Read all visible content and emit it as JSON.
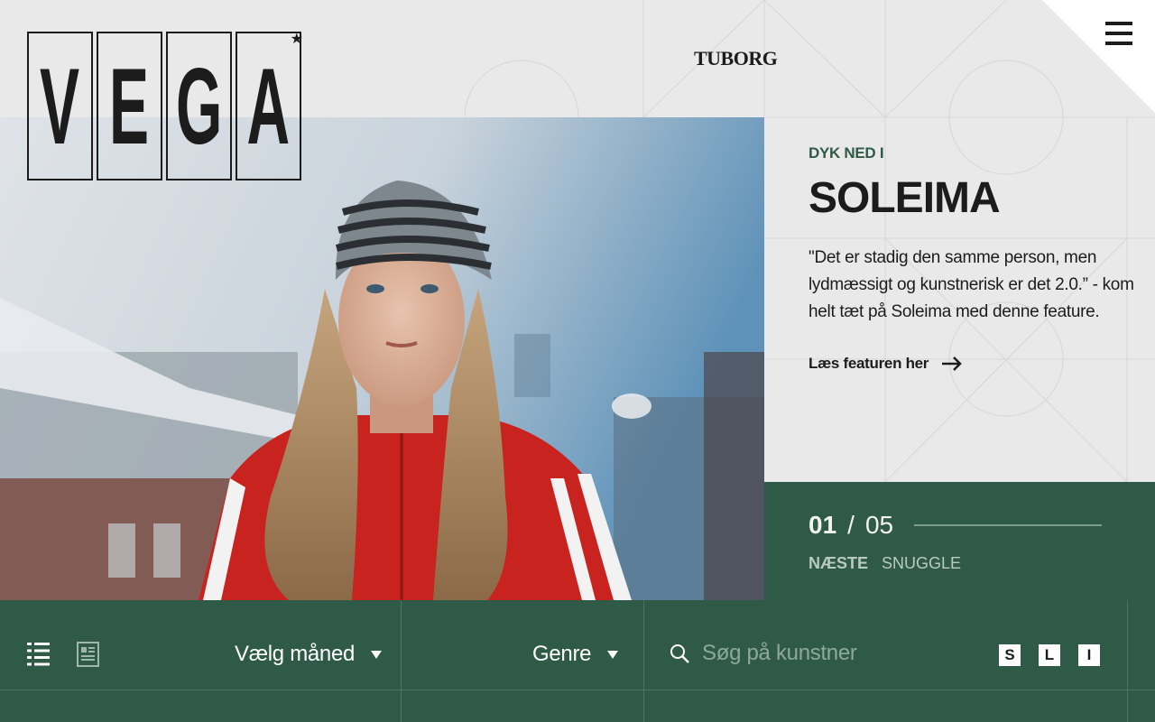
{
  "header": {
    "logo_letters": [
      "V",
      "E",
      "G",
      "A"
    ],
    "logo_star": "★",
    "sponsor": "TUBORG",
    "menu_icon": "hamburger-menu-icon"
  },
  "feature": {
    "eyebrow": "DYK NED I",
    "artist": "SOLEIMA",
    "quote": "\"Det er stadig den samme person, men lydmæssigt og kunstnerisk er det 2.0.” - kom helt tæt på Soleima med denne feature.",
    "cta_label": "Læs featuren her",
    "cta_icon": "arrow-right-icon"
  },
  "slider": {
    "current": "01",
    "separator": "/",
    "total": "05",
    "next_label": "NÆSTE",
    "next_title": "SNUGGLE"
  },
  "filters": {
    "list_view_icon": "list-view-icon",
    "document_view_icon": "document-view-icon",
    "month_label": "Vælg måned",
    "genre_label": "Genre",
    "search_icon": "search-icon",
    "search_placeholder": "Søg på kunstner",
    "sizes": [
      "S",
      "L",
      "I"
    ]
  },
  "colors": {
    "accent_green": "#2f5a47",
    "background": "#e9e9e9",
    "text": "#1c1c1c"
  }
}
